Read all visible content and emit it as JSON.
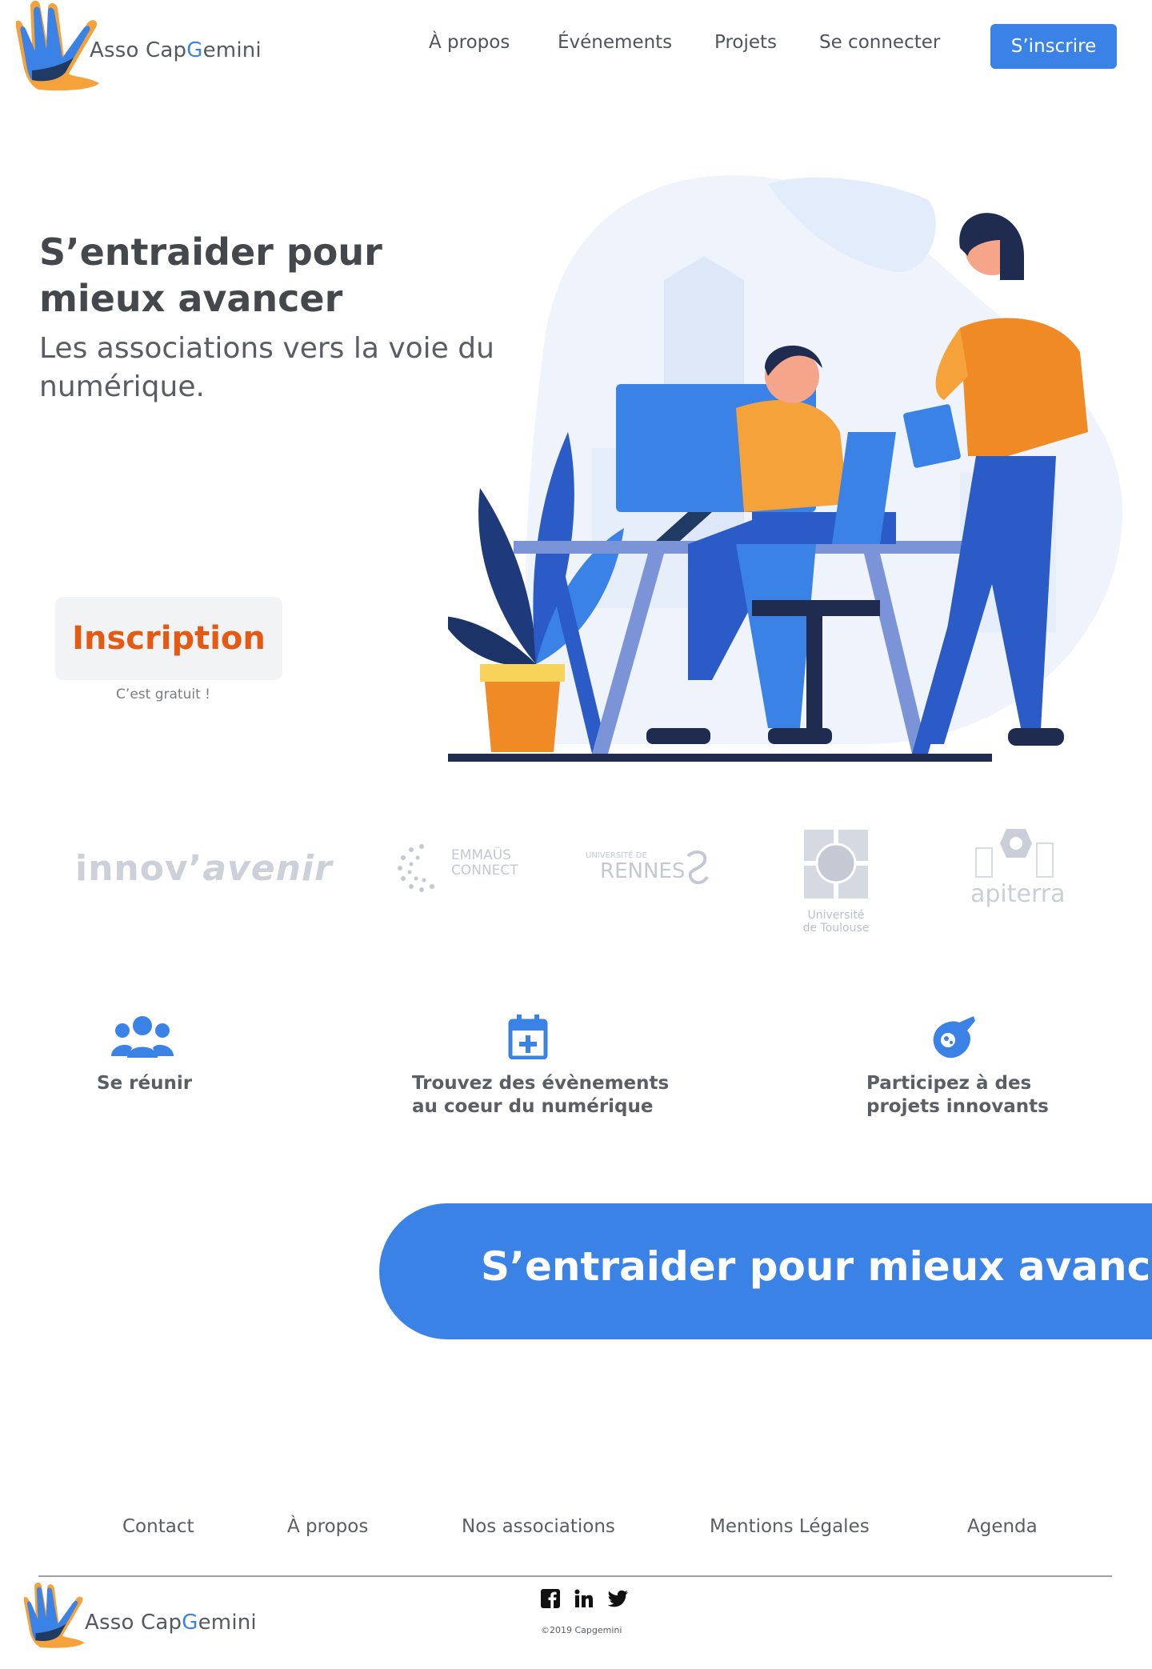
{
  "brand": {
    "prefix": "Asso Cap",
    "g": "G",
    "suffix": "emini"
  },
  "nav": {
    "apropos": "À propos",
    "events": "Événements",
    "projets": "Projets",
    "login": "Se connecter",
    "signup": "S’inscrire"
  },
  "hero": {
    "title": "S’entraider pour mieux avancer",
    "subtitle": "Les associations vers la voie du numérique.",
    "cta_label": "Inscription",
    "cta_note": "C’est gratuit !"
  },
  "partners": {
    "innov_a": "innov’",
    "innov_b": "avenir",
    "emmaus_1": "EMMAÜS",
    "emmaus_2": "CONNECT",
    "rennes_small": "UNIVERSITÉ DE",
    "rennes_big": "RENNES",
    "toulouse_1": "Université",
    "toulouse_2": "de Toulouse",
    "apiterra": "apiterra"
  },
  "features": {
    "f1": "Se réunir",
    "f2_1": "Trouvez des évènements",
    "f2_2": "au coeur du numérique",
    "f3_1": "Participez à des",
    "f3_2": "projets innovants"
  },
  "banner": {
    "text": "S’entraider pour mieux avancer"
  },
  "footer": {
    "links": [
      "Contact",
      "À propos",
      "Nos associations",
      "Mentions Légales",
      "Agenda"
    ],
    "copyright": "©2019 Capgemini"
  },
  "icons": {
    "logo": "hand-logo-icon",
    "social": [
      "facebook-icon",
      "linkedin-icon",
      "twitter-icon"
    ],
    "features": [
      "group-icon",
      "calendar-plus-icon",
      "rocket-icon"
    ]
  },
  "colors": {
    "accent": "#3b82e6",
    "cta": "#e55a12",
    "orange": "#f6a23a"
  }
}
